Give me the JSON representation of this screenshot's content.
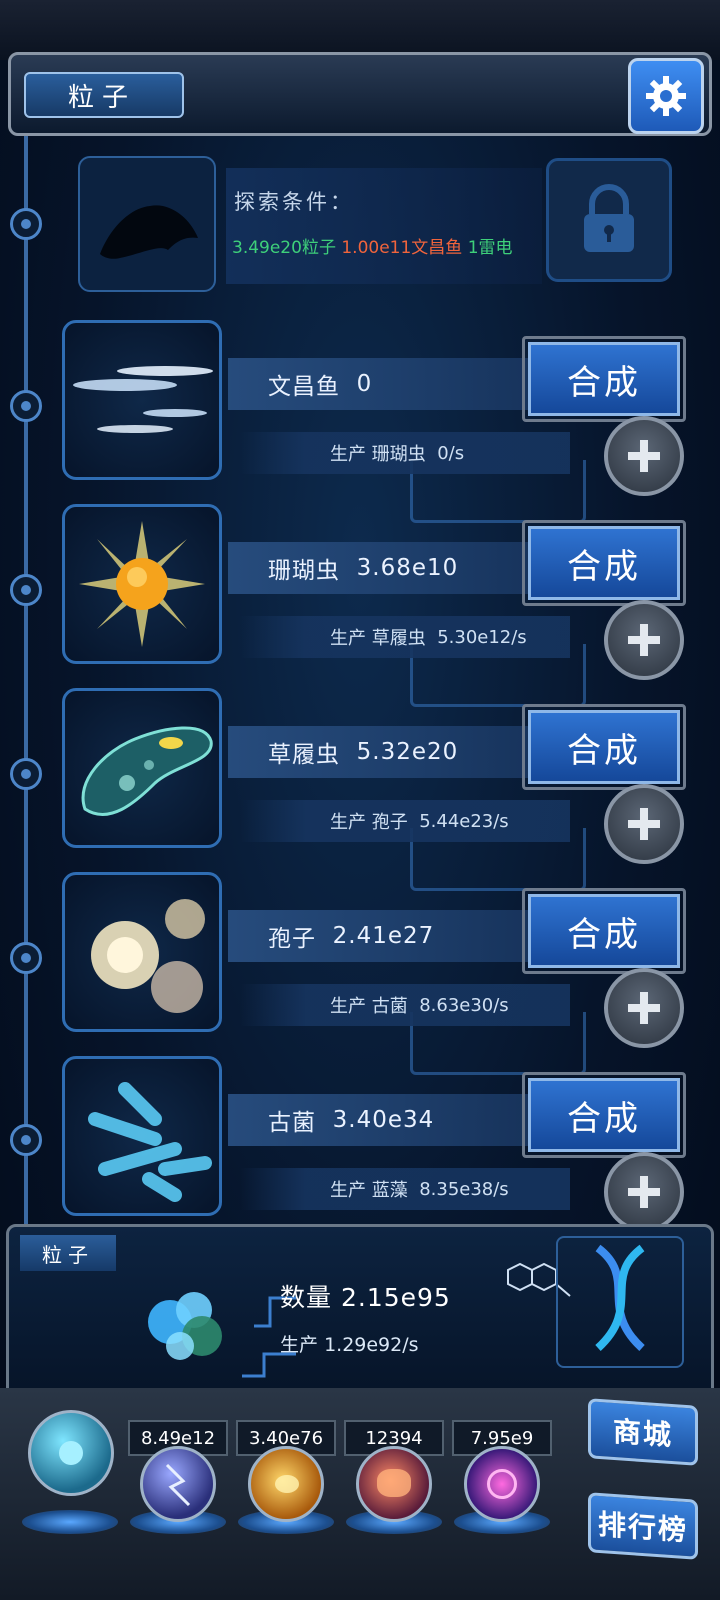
{
  "header": {
    "title": "粒子"
  },
  "locked": {
    "condition_title": "探索条件：",
    "requirements": [
      {
        "text": "3.49e20粒子",
        "color": "#3ed07a"
      },
      {
        "text": "1.00e11文昌鱼",
        "color": "#f0643c"
      },
      {
        "text": "1雷电",
        "color": "#3ed07a"
      }
    ]
  },
  "rows": [
    {
      "name": "文昌鱼",
      "count": "0",
      "produce_label": "生产",
      "produce_target": "珊瑚虫",
      "rate": "0/s",
      "synth_label": "合成"
    },
    {
      "name": "珊瑚虫",
      "count": "3.68e10",
      "produce_label": "生产",
      "produce_target": "草履虫",
      "rate": "5.30e12/s",
      "synth_label": "合成"
    },
    {
      "name": "草履虫",
      "count": "5.32e20",
      "produce_label": "生产",
      "produce_target": "孢子",
      "rate": "5.44e23/s",
      "synth_label": "合成"
    },
    {
      "name": "孢子",
      "count": "2.41e27",
      "produce_label": "生产",
      "produce_target": "古菌",
      "rate": "8.63e30/s",
      "synth_label": "合成"
    },
    {
      "name": "古菌",
      "count": "3.40e34",
      "produce_label": "生产",
      "produce_target": "蓝藻",
      "rate": "8.35e38/s",
      "synth_label": "合成"
    }
  ],
  "summary": {
    "label": "粒子",
    "quantity_label": "数量",
    "quantity": "2.15e95",
    "produce_label": "生产",
    "produce_rate": "1.29e92/s"
  },
  "resources": [
    "8.49e12",
    "3.40e76",
    "12394",
    "7.95e9"
  ],
  "side_buttons": {
    "shop": "商城",
    "leaderboard": "排行榜"
  },
  "colors": {
    "accent": "#2f73d1",
    "rail": "#3b6aa4"
  }
}
